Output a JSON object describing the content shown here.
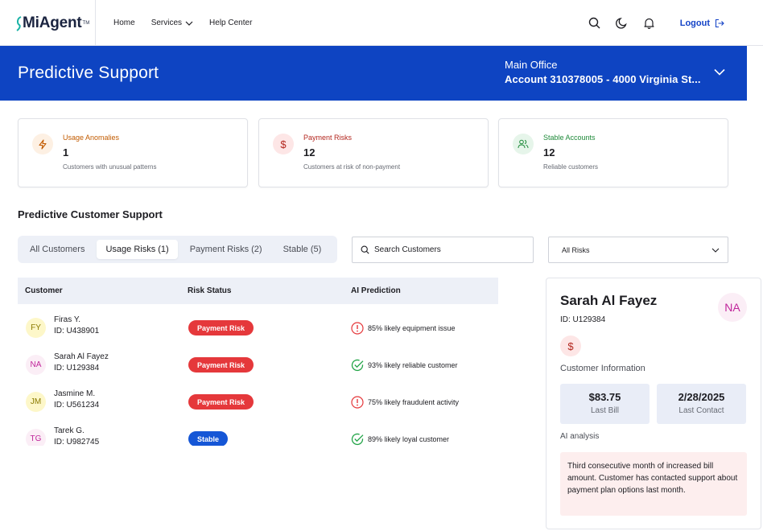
{
  "nav": {
    "logo_prefix": "Mi",
    "logo_suffix": "Agent",
    "logo_tm": "TM",
    "links": [
      "Home",
      "Services",
      "Help Center"
    ],
    "logout_label": "Logout"
  },
  "banner": {
    "title": "Predictive Support",
    "account_label": "Main Office",
    "account_value": "Account 310378005 - 4000 Virginia St..."
  },
  "cards": [
    {
      "label": "Usage Anomalies",
      "value": "1",
      "desc": "Customers with unusual patterns",
      "color": "#c25b00",
      "icon": "lightning-icon"
    },
    {
      "label": "Payment Risks",
      "value": "12",
      "desc": "Customers at risk of non-payment",
      "color": "#b3261e",
      "icon": "dollar-icon"
    },
    {
      "label": "Stable Accounts",
      "value": "12",
      "desc": "Reliable customers",
      "color": "#1f8a3a",
      "icon": "users-icon"
    }
  ],
  "section_title": "Predictive Customer Support",
  "tabs": [
    "All Customers",
    "Usage Risks (1)",
    "Payment Risks (2)",
    "Stable (5)"
  ],
  "active_tab": 1,
  "search": {
    "placeholder": "Search Customers"
  },
  "risk_filter": {
    "selected": "All Risks"
  },
  "table": {
    "headers": [
      "Customer",
      "Risk Status",
      "AI Prediction"
    ],
    "rows": [
      {
        "initials": "FY",
        "name": "Firas Y.",
        "id": "ID: U438901",
        "status": "Payment Risk",
        "prediction": "85% likely equipment issue"
      },
      {
        "initials": "NA",
        "name": "Sarah Al Fayez",
        "id": "ID: U129384",
        "status": "Payment Risk",
        "prediction": "93% likely reliable customer"
      },
      {
        "initials": "JM",
        "name": "Jasmine M.",
        "id": "ID: U561234",
        "status": "Payment Risk",
        "prediction": "75% likely fraudulent activity"
      },
      {
        "initials": "TG",
        "name": "Tarek G.",
        "id": "ID: U982745",
        "status": "Stable",
        "prediction": "89% likely loyal customer"
      }
    ]
  },
  "detail": {
    "name": "Sarah Al Fayez",
    "id": "ID: U129384",
    "initials": "NA",
    "customer_info_label": "Customer Information",
    "last_bill_value": "$83.75",
    "last_bill_label": "Last Bill",
    "last_contact_value": "2/28/2025",
    "last_contact_label": "Last Contact",
    "ai_label": "AI analysis",
    "ai_note": "Third consecutive month of increased bill amount. Customer has contacted support about payment plan options last month."
  },
  "colors": {
    "brand_blue": "#0e44c2",
    "payment_risk": "#e5383b",
    "stable": "#1556d6",
    "warning_icon": "#e5383b",
    "check_icon": "#22a447"
  }
}
